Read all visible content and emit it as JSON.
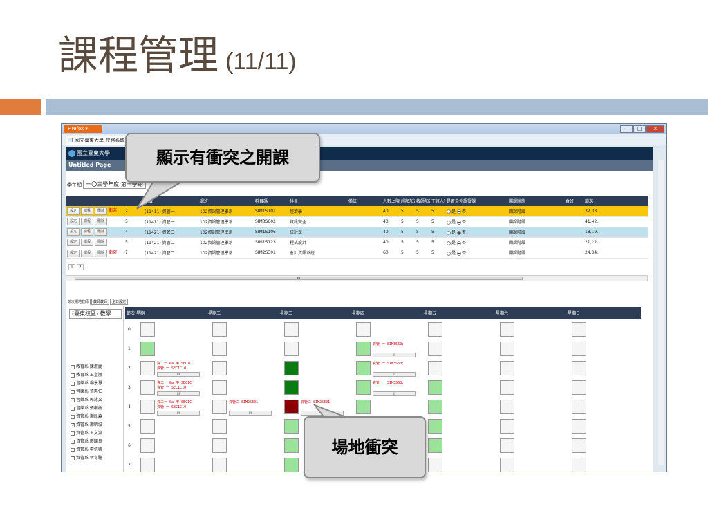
{
  "slide": {
    "title": "課程管理",
    "title_num": "(11/11)"
  },
  "browser": {
    "menu_label": "Firefox ▾",
    "tab_title": "國立臺東大學-校務系統",
    "logo_text": "國立臺東大學",
    "page_title": "Untitled Page",
    "window_controls": [
      "—",
      "□",
      "x"
    ]
  },
  "filters": {
    "year_label": "學年期",
    "year_value": "一〇三學年度 第一學期"
  },
  "course_grid": {
    "headers": [
      "",
      "",
      "年級",
      "課班",
      "科目碼",
      "科目",
      "備註",
      "人數上限",
      "超額加選人數",
      "教師加選人數",
      "下修人數限制",
      "是否全外語授課",
      "開課狀態",
      "合班",
      "節次"
    ],
    "buttons": [
      "設定",
      "課程",
      "刪除"
    ],
    "radio_yes": "是",
    "radio_no": "否",
    "rows": [
      {
        "conflict": "衝突",
        "seq": "2",
        "grade": "(11411) 資管一",
        "dept": "102資訊管理學系",
        "code": "SIM1S101",
        "subject": "經濟學",
        "cap": "40",
        "a": "5",
        "b": "5",
        "c": "5",
        "status": "開課階段",
        "periods": "32,33,",
        "style": "row-hl"
      },
      {
        "conflict": "",
        "seq": "3",
        "grade": "(11411) 資管一",
        "dept": "102資訊管理學系",
        "code": "SIM3S602",
        "subject": "資訊安全",
        "cap": "40",
        "a": "5",
        "b": "5",
        "c": "5",
        "status": "開課階段",
        "periods": "41,42,",
        "style": ""
      },
      {
        "conflict": "",
        "seq": "4",
        "grade": "(11421) 資管二",
        "dept": "102資訊管理學系",
        "code": "SIM1S106",
        "subject": "統計學一",
        "cap": "40",
        "a": "5",
        "b": "5",
        "c": "5",
        "status": "開課階段",
        "periods": "18,19,",
        "style": "row-sel"
      },
      {
        "conflict": "",
        "seq": "5",
        "grade": "(11421) 資管二",
        "dept": "102資訊管理學系",
        "code": "SIM1S123",
        "subject": "程式設計",
        "cap": "40",
        "a": "5",
        "b": "5",
        "c": "5",
        "status": "開課階段",
        "periods": "21,22,",
        "style": ""
      },
      {
        "conflict": "衝突",
        "seq": "7",
        "grade": "(11421) 資管二",
        "dept": "102資訊管理學系",
        "code": "SIM2S301",
        "subject": "會計資訊系統",
        "cap": "60",
        "a": "5",
        "b": "5",
        "c": "5",
        "status": "開課階段",
        "periods": "24,34,",
        "style": ""
      }
    ],
    "pages": [
      "1",
      "2"
    ],
    "scroll_label": "III"
  },
  "subtabs": [
    "節次場地教師",
    "教師教師",
    "全日設定"
  ],
  "left_panel": {
    "campus": "(臺東校區) 教學",
    "teachers": [
      {
        "name": "教育系 陳淑麗",
        "checked": false
      },
      {
        "name": "教育系 王宣嵐",
        "checked": false
      },
      {
        "name": "音樂系 楊景慧",
        "checked": false
      },
      {
        "name": "音樂系 張惠仁",
        "checked": false
      },
      {
        "name": "音樂系 郭詠文",
        "checked": false
      },
      {
        "name": "音樂系 張樹樹",
        "checked": false
      },
      {
        "name": "資管系 謝民森",
        "checked": false
      },
      {
        "name": "資管系 謝明城",
        "checked": true
      },
      {
        "name": "資管系 王文淵",
        "checked": false
      },
      {
        "name": "資管系 廖國良",
        "checked": false
      },
      {
        "name": "資管系 李信興",
        "checked": false
      },
      {
        "name": "資管系 林育聰",
        "checked": false
      }
    ]
  },
  "schedule": {
    "period_header": "節次",
    "days": [
      "星期一",
      "星期二",
      "星期三",
      "星期四",
      "星期五",
      "星期六",
      "星期日"
    ],
    "periods": [
      "0",
      "1",
      "2",
      "3",
      "4",
      "5",
      "6",
      "7"
    ],
    "labels": {
      "mon2a": "資工一 &a 甲 SEC1C",
      "mon2b": "資管 一 SEC1C10;",
      "thu1": "資管 一 SIM3S60;",
      "thu2": "資管 一 SIM3S60;",
      "thu3": "資管 一 SIM3S60;",
      "tue4": "資管二 SIM2S301",
      "wed4": "資管二 SIM2S301"
    },
    "mini_label": "III"
  },
  "callouts": {
    "conflict_course": "顯示有衝突之開課",
    "room_conflict": "場地衝突"
  }
}
